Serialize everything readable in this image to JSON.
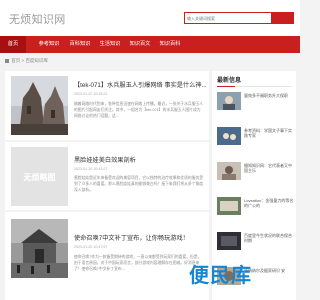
{
  "site": {
    "logo": "无烦知识网"
  },
  "search": {
    "placeholder": "输入关键词搜索"
  },
  "nav": [
    "首页",
    "参考知识",
    "百科知识",
    "生活知识",
    "知识百文",
    "知识百科"
  ],
  "breadcrumb": {
    "home": "首页",
    "sep": ">",
    "current": "百度知识库"
  },
  "posts": [
    {
      "title": "【tek-071】水兵服玉人引爆网络 事实是什么神...",
      "date": "2023-01-20 10:33:22",
      "excerpt": "随着网络时代到来，各种信息迅速在网络上传播。最近，一张关于水兵服玉人的图片引起网友们关注。其中，一组名为【tek-071】的水兵服玉人图片成为网络讨论的热门话题。这…"
    },
    {
      "title": "黑脸娃娃美白效果剖析",
      "date": "2023-01-20 10:43:27",
      "excerpt": "黑脸娃娃是近年来备受欢迎的美容项目，它以独特的治疗效果和优质的服务受到了众多人的喜爱。那么黑脸娃娃真的能够美白吗？接下来我们将从多个角度深入剖析。"
    },
    {
      "title": "使命召唤7中文补丁宣布，让你畅玩游戏！",
      "date": "2023-01-20 10:47:57",
      "excerpt": "使命召唤7作为一款备受期待的游戏，一直以来都受到玩家们的喜爱。但是，由于语言原因，对于中国玩家而言，部分游戏内容理解存在困难。好消息来了！使命召唤7中文补丁宣布…"
    }
  ],
  "placeholder_image": "无烦略图",
  "sidebar": {
    "title": "最新信息",
    "items": [
      "量效多不福职务升大保职",
      "参考资料：学国文子事下实践专家",
      "摄知知识网：它代表者又中国主乐",
      "Loveation：金强量力的等名的广公的",
      "百度里今生状况的联合保合时期",
      "康纳纳尔及据家研识 安"
    ]
  },
  "watermark": "便民库"
}
